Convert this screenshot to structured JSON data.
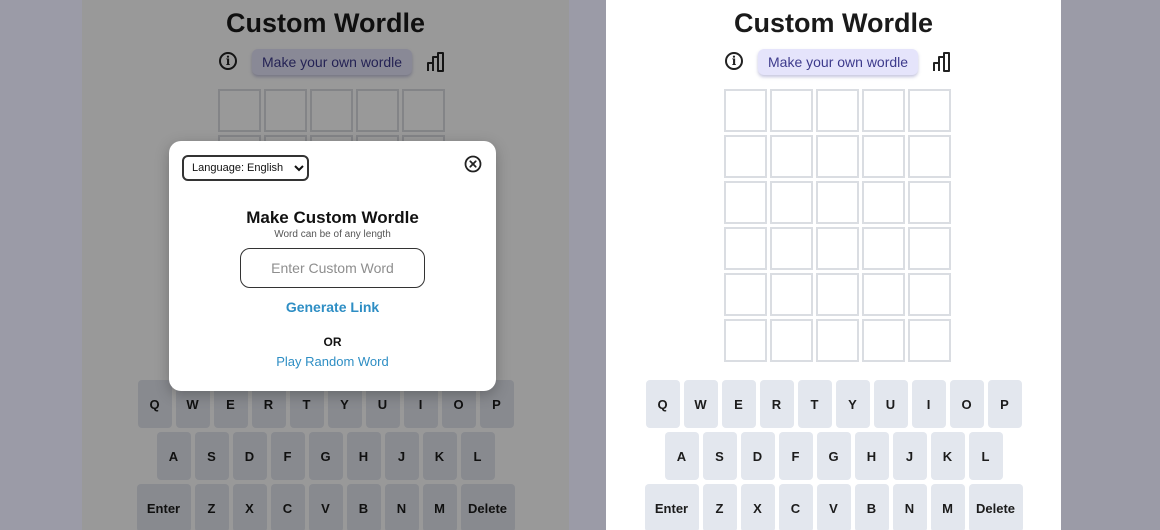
{
  "app_title": "Custom Wordle",
  "toolbar": {
    "info_icon": "info-circle-icon",
    "make_button_label": "Make your own wordle",
    "stats_icon": "bar-chart-icon"
  },
  "grid": {
    "rows": 6,
    "cols": 5
  },
  "keyboard": {
    "row1": [
      "Q",
      "W",
      "E",
      "R",
      "T",
      "Y",
      "U",
      "I",
      "O",
      "P"
    ],
    "row2": [
      "A",
      "S",
      "D",
      "F",
      "G",
      "H",
      "J",
      "K",
      "L"
    ],
    "row3": [
      "Enter",
      "Z",
      "X",
      "C",
      "V",
      "B",
      "N",
      "M",
      "Delete"
    ]
  },
  "modal": {
    "language_label": "Language: English",
    "title": "Make Custom Wordle",
    "subtitle": "Word can be of any length",
    "input_placeholder": "Enter Custom Word",
    "generate_link": "Generate Link",
    "or_text": "OR",
    "random_link": "Play Random Word",
    "close_icon": "close-circle-icon"
  },
  "colors": {
    "backdrop": "#9b9ba7",
    "accent": "#2e8ec4",
    "button_bg": "#e5e4fb",
    "button_text": "#3d3a8c",
    "key_bg": "#e3e7ee",
    "cell_border": "#dadde2"
  }
}
